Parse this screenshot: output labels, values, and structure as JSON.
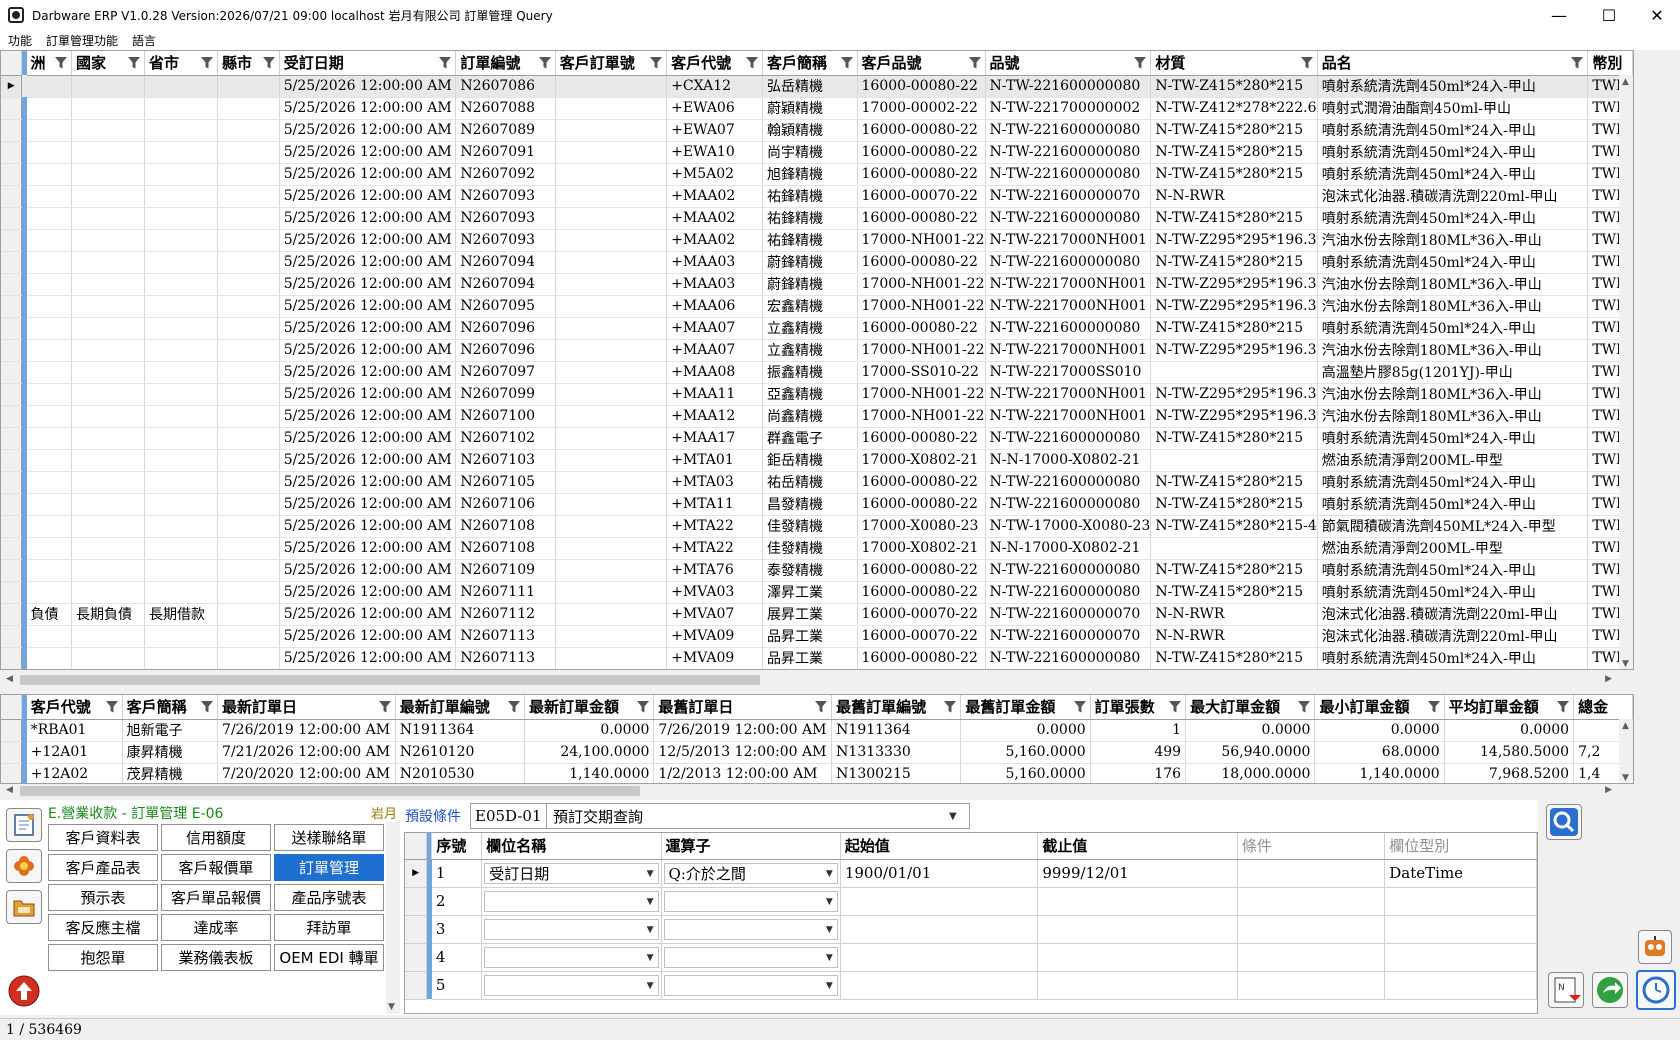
{
  "window": {
    "title": "Darbware ERP V1.0.28 Version:2026/07/21 09:00   localhost 岩月有限公司 訂單管理 Query",
    "minimize": "—",
    "maximize": "☐",
    "close": "✕"
  },
  "menu": [
    "功能",
    "訂單管理功能",
    "語言"
  ],
  "main_grid": {
    "columns": [
      "洲",
      "國家",
      "省市",
      "縣市",
      "受訂日期",
      "訂單編號",
      "客戶訂單號",
      "客戶代號",
      "客戶簡稱",
      "客戶品號",
      "品號",
      "材質",
      "品名",
      "幣別"
    ],
    "rows": [
      [
        "",
        "",
        "",
        "",
        "5/25/2026 12:00:00 AM",
        "N2607086",
        "",
        "+CXA12",
        "弘岳精機",
        "16000-00080-22",
        "N-TW-221600000080",
        "N-TW-Z415*280*215",
        "噴射系統清洗劑450ml*24入-甲山",
        "TWD"
      ],
      [
        "",
        "",
        "",
        "",
        "5/25/2026 12:00:00 AM",
        "N2607088",
        "",
        "+EWA06",
        "蔚穎精機",
        "17000-00002-22",
        "N-TW-221700000002",
        "N-TW-Z412*278*222.6",
        "噴射式潤滑油酯劑450ml-甲山",
        "TWD"
      ],
      [
        "",
        "",
        "",
        "",
        "5/25/2026 12:00:00 AM",
        "N2607089",
        "",
        "+EWA07",
        "翰穎精機",
        "16000-00080-22",
        "N-TW-221600000080",
        "N-TW-Z415*280*215",
        "噴射系統清洗劑450ml*24入-甲山",
        "TWD"
      ],
      [
        "",
        "",
        "",
        "",
        "5/25/2026 12:00:00 AM",
        "N2607091",
        "",
        "+EWA10",
        "尚宇精機",
        "16000-00080-22",
        "N-TW-221600000080",
        "N-TW-Z415*280*215",
        "噴射系統清洗劑450ml*24入-甲山",
        "TWD"
      ],
      [
        "",
        "",
        "",
        "",
        "5/25/2026 12:00:00 AM",
        "N2607092",
        "",
        "+M5A02",
        "旭鋒精機",
        "16000-00080-22",
        "N-TW-221600000080",
        "N-TW-Z415*280*215",
        "噴射系統清洗劑450ml*24入-甲山",
        "TWD"
      ],
      [
        "",
        "",
        "",
        "",
        "5/25/2026 12:00:00 AM",
        "N2607093",
        "",
        "+MAA02",
        "祐鋒精機",
        "16000-00070-22",
        "N-TW-221600000070",
        "N-N-RWR",
        "泡沫式化油器.積碳清洗劑220ml-甲山",
        "TWD"
      ],
      [
        "",
        "",
        "",
        "",
        "5/25/2026 12:00:00 AM",
        "N2607093",
        "",
        "+MAA02",
        "祐鋒精機",
        "16000-00080-22",
        "N-TW-221600000080",
        "N-TW-Z415*280*215",
        "噴射系統清洗劑450ml*24入-甲山",
        "TWD"
      ],
      [
        "",
        "",
        "",
        "",
        "5/25/2026 12:00:00 AM",
        "N2607093",
        "",
        "+MAA02",
        "祐鋒精機",
        "17000-NH001-22",
        "N-TW-2217000NH001",
        "N-TW-Z295*295*196.3",
        "汽油水份去除劑180ML*36入-甲山",
        "TWD"
      ],
      [
        "",
        "",
        "",
        "",
        "5/25/2026 12:00:00 AM",
        "N2607094",
        "",
        "+MAA03",
        "蔚鋒精機",
        "16000-00080-22",
        "N-TW-221600000080",
        "N-TW-Z415*280*215",
        "噴射系統清洗劑450ml*24入-甲山",
        "TWD"
      ],
      [
        "",
        "",
        "",
        "",
        "5/25/2026 12:00:00 AM",
        "N2607094",
        "",
        "+MAA03",
        "蔚鋒精機",
        "17000-NH001-22",
        "N-TW-2217000NH001",
        "N-TW-Z295*295*196.3",
        "汽油水份去除劑180ML*36入-甲山",
        "TWD"
      ],
      [
        "",
        "",
        "",
        "",
        "5/25/2026 12:00:00 AM",
        "N2607095",
        "",
        "+MAA06",
        "宏鑫精機",
        "17000-NH001-22",
        "N-TW-2217000NH001",
        "N-TW-Z295*295*196.3",
        "汽油水份去除劑180ML*36入-甲山",
        "TWD"
      ],
      [
        "",
        "",
        "",
        "",
        "5/25/2026 12:00:00 AM",
        "N2607096",
        "",
        "+MAA07",
        "立鑫精機",
        "16000-00080-22",
        "N-TW-221600000080",
        "N-TW-Z415*280*215",
        "噴射系統清洗劑450ml*24入-甲山",
        "TWD"
      ],
      [
        "",
        "",
        "",
        "",
        "5/25/2026 12:00:00 AM",
        "N2607096",
        "",
        "+MAA07",
        "立鑫精機",
        "17000-NH001-22",
        "N-TW-2217000NH001",
        "N-TW-Z295*295*196.3",
        "汽油水份去除劑180ML*36入-甲山",
        "TWD"
      ],
      [
        "",
        "",
        "",
        "",
        "5/25/2026 12:00:00 AM",
        "N2607097",
        "",
        "+MAA08",
        "振鑫精機",
        "17000-SS010-22",
        "N-TW-2217000SS010",
        "",
        "高溫墊片膠85g(1201YJ)-甲山",
        "TWD"
      ],
      [
        "",
        "",
        "",
        "",
        "5/25/2026 12:00:00 AM",
        "N2607099",
        "",
        "+MAA11",
        "亞鑫精機",
        "17000-NH001-22",
        "N-TW-2217000NH001",
        "N-TW-Z295*295*196.3",
        "汽油水份去除劑180ML*36入-甲山",
        "TWD"
      ],
      [
        "",
        "",
        "",
        "",
        "5/25/2026 12:00:00 AM",
        "N2607100",
        "",
        "+MAA12",
        "尚鑫精機",
        "17000-NH001-22",
        "N-TW-2217000NH001",
        "N-TW-Z295*295*196.3",
        "汽油水份去除劑180ML*36入-甲山",
        "TWD"
      ],
      [
        "",
        "",
        "",
        "",
        "5/25/2026 12:00:00 AM",
        "N2607102",
        "",
        "+MAA17",
        "群鑫電子",
        "16000-00080-22",
        "N-TW-221600000080",
        "N-TW-Z415*280*215",
        "噴射系統清洗劑450ml*24入-甲山",
        "TWD"
      ],
      [
        "",
        "",
        "",
        "",
        "5/25/2026 12:00:00 AM",
        "N2607103",
        "",
        "+MTA01",
        "鉅岳精機",
        "17000-X0802-21",
        "N-N-17000-X0802-21",
        "",
        "燃油系統清淨劑200ML-甲型",
        "TWD"
      ],
      [
        "",
        "",
        "",
        "",
        "5/25/2026 12:00:00 AM",
        "N2607105",
        "",
        "+MTA03",
        "祐岳精機",
        "16000-00080-22",
        "N-TW-221600000080",
        "N-TW-Z415*280*215",
        "噴射系統清洗劑450ml*24入-甲山",
        "TWD"
      ],
      [
        "",
        "",
        "",
        "",
        "5/25/2026 12:00:00 AM",
        "N2607106",
        "",
        "+MTA11",
        "昌發精機",
        "16000-00080-22",
        "N-TW-221600000080",
        "N-TW-Z415*280*215",
        "噴射系統清洗劑450ml*24入-甲山",
        "TWD"
      ],
      [
        "",
        "",
        "",
        "",
        "5/25/2026 12:00:00 AM",
        "N2607108",
        "",
        "+MTA22",
        "佳發精機",
        "17000-X0080-23",
        "N-TW-17000-X0080-23",
        "N-TW-Z415*280*215-4",
        "節氣閥積碳清洗劑450ML*24入-甲型",
        "TWD"
      ],
      [
        "",
        "",
        "",
        "",
        "5/25/2026 12:00:00 AM",
        "N2607108",
        "",
        "+MTA22",
        "佳發精機",
        "17000-X0802-21",
        "N-N-17000-X0802-21",
        "",
        "燃油系統清淨劑200ML-甲型",
        "TWD"
      ],
      [
        "",
        "",
        "",
        "",
        "5/25/2026 12:00:00 AM",
        "N2607109",
        "",
        "+MTA76",
        "泰發精機",
        "16000-00080-22",
        "N-TW-221600000080",
        "N-TW-Z415*280*215",
        "噴射系統清洗劑450ml*24入-甲山",
        "TWD"
      ],
      [
        "",
        "",
        "",
        "",
        "5/25/2026 12:00:00 AM",
        "N2607111",
        "",
        "+MVA03",
        "澤昇工業",
        "16000-00080-22",
        "N-TW-221600000080",
        "N-TW-Z415*280*215",
        "噴射系統清洗劑450ml*24入-甲山",
        "TWD"
      ],
      [
        "負債",
        "長期負債",
        "長期借款",
        "",
        "5/25/2026 12:00:00 AM",
        "N2607112",
        "",
        "+MVA07",
        "展昇工業",
        "16000-00070-22",
        "N-TW-221600000070",
        "N-N-RWR",
        "泡沫式化油器.積碳清洗劑220ml-甲山",
        "TWD"
      ],
      [
        "",
        "",
        "",
        "",
        "5/25/2026 12:00:00 AM",
        "N2607113",
        "",
        "+MVA09",
        "品昇工業",
        "16000-00070-22",
        "N-TW-221600000070",
        "N-N-RWR",
        "泡沫式化油器.積碳清洗劑220ml-甲山",
        "TWD"
      ],
      [
        "",
        "",
        "",
        "",
        "5/25/2026 12:00:00 AM",
        "N2607113",
        "",
        "+MVA09",
        "品昇工業",
        "16000-00080-22",
        "N-TW-221600000080",
        "N-TW-Z415*280*215",
        "噴射系統清洗劑450ml*24入-甲山",
        "TWD"
      ]
    ]
  },
  "summary_grid": {
    "columns": [
      "客戶代號",
      "客戶簡稱",
      "最新訂單日",
      "最新訂單編號",
      "最新訂單金額",
      "最舊訂單日",
      "最舊訂單編號",
      "最舊訂單金額",
      "訂單張數",
      "最大訂單金額",
      "最小訂單金額",
      "平均訂單金額",
      "總金"
    ],
    "rows": [
      [
        "*RBA01",
        "旭新電子",
        "7/26/2019 12:00:00 AM",
        "N1911364",
        "0.0000",
        "7/26/2019 12:00:00 AM",
        "N1911364",
        "0.0000",
        "1",
        "0.0000",
        "0.0000",
        "0.0000",
        ""
      ],
      [
        "+12A01",
        "康昇精機",
        "7/21/2026 12:00:00 AM",
        "N2610120",
        "24,100.0000",
        "12/5/2013 12:00:00 AM",
        "N1313330",
        "5,160.0000",
        "499",
        "56,940.0000",
        "68.0000",
        "14,580.5000",
        "7,2"
      ],
      [
        "+12A02",
        "茂昇精機",
        "7/20/2020 12:00:00 AM",
        "N2010530",
        "1,140.0000",
        "1/2/2013 12:00:00 AM",
        "N1300215",
        "5,160.0000",
        "176",
        "18,000.0000",
        "1,140.0000",
        "7,968.5200",
        "1,4"
      ]
    ]
  },
  "module_panel": {
    "title": "E.營業收款 - 訂單管理  E-06",
    "company_tag": "岩月",
    "buttons": [
      "客戶資料表",
      "信用額度",
      "送樣聯絡單",
      "客戶產品表",
      "客戶報價單",
      "訂單管理",
      "預示表",
      "客戶單品報價",
      "產品序號表",
      "客反應主檔",
      "達成率",
      "拜訪單",
      "抱怨單",
      "業務儀表板",
      "OEM EDI 轉單"
    ],
    "active_button": "訂單管理"
  },
  "condition": {
    "label": "預設條件",
    "code": "E05D-01",
    "name": "預訂交期查詢",
    "columns": [
      "序號",
      "欄位名稱",
      "運算子",
      "起始值",
      "截止值",
      "條件",
      "欄位型別"
    ],
    "rows": [
      [
        "1",
        "受訂日期",
        "Q:介於之間",
        "1900/01/01",
        "9999/12/01",
        "",
        "DateTime"
      ],
      [
        "2",
        "",
        "",
        "",
        "",
        "",
        ""
      ],
      [
        "3",
        "",
        "",
        "",
        "",
        "",
        ""
      ],
      [
        "4",
        "",
        "",
        "",
        "",
        "",
        ""
      ],
      [
        "5",
        "",
        "",
        "",
        "",
        "",
        ""
      ]
    ]
  },
  "status": {
    "record": "1 / 536469"
  },
  "colors": {
    "accent": "#1e6fd0",
    "indicator": "#6fa6e0",
    "panel_title": "#1a8a1a",
    "cond_label": "#1e50c8"
  }
}
